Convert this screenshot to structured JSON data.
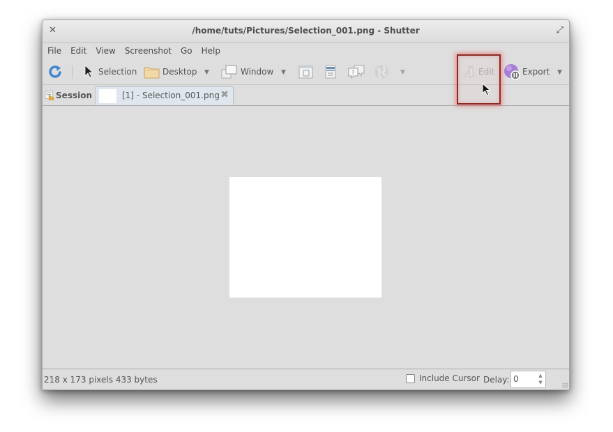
{
  "window": {
    "title": "/home/tuts/Pictures/Selection_001.png - Shutter",
    "close_glyph": "✕",
    "maximize_glyph": "⤢"
  },
  "menu": {
    "items": [
      {
        "label": "File"
      },
      {
        "label": "Edit"
      },
      {
        "label": "View"
      },
      {
        "label": "Screenshot"
      },
      {
        "label": "Go"
      },
      {
        "label": "Help"
      }
    ]
  },
  "toolbar": {
    "refresh_icon": "refresh-icon",
    "selection_label": "Selection",
    "desktop_label": "Desktop",
    "window_label": "Window",
    "edit_label": "Edit",
    "export_label": "Export",
    "dropdown_glyph": "▼"
  },
  "tabs": {
    "session_label": "Session",
    "active_tab_label": "[1] - Selection_001.png",
    "close_glyph": "✖"
  },
  "status": {
    "info": "218 x 173 pixels  433 bytes",
    "include_cursor_label": "Include Cursor",
    "include_cursor_checked": false,
    "delay_label": "Delay:",
    "delay_value": "0",
    "spin_up": "▲",
    "spin_down": "▼"
  },
  "colors": {
    "highlight_border": "#8a2a24",
    "export_icon": "#a77fd6",
    "refresh_icon": "#3f86d1"
  }
}
